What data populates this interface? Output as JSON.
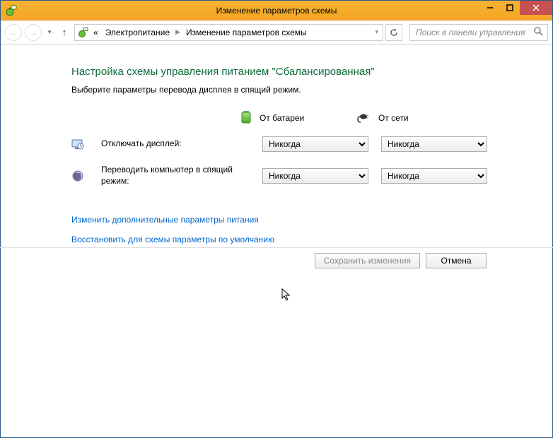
{
  "window": {
    "title": "Изменение параметров схемы"
  },
  "breadcrumb": {
    "root_glyph": "«",
    "items": [
      "Электропитание",
      "Изменение параметров схемы"
    ]
  },
  "search": {
    "placeholder": "Поиск в панели управления"
  },
  "page": {
    "heading": "Настройка схемы управления питанием \"Сбалансированная\"",
    "subheading": "Выберите параметры перевода дисплея в спящий режим."
  },
  "columns": {
    "battery": "От батареи",
    "plugged": "От сети"
  },
  "rows": [
    {
      "label": "Отключать дисплей:",
      "battery": "Никогда",
      "plugged": "Никогда"
    },
    {
      "label": "Переводить компьютер в спящий режим:",
      "battery": "Никогда",
      "plugged": "Никогда"
    }
  ],
  "links": {
    "advanced": "Изменить дополнительные параметры питания",
    "restore": "Восстановить для схемы параметры по умолчанию"
  },
  "buttons": {
    "save": "Сохранить изменения",
    "cancel": "Отмена"
  }
}
